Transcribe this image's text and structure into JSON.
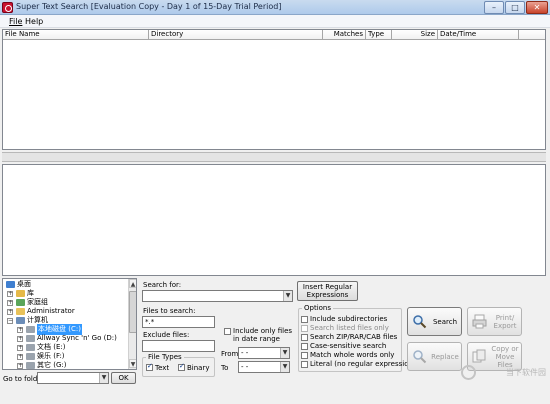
{
  "window": {
    "title": "Super Text Search [Evaluation Copy - Day 1 of 15-Day Trial Period]",
    "buttons": [
      "–",
      "□",
      "✕"
    ]
  },
  "menu": [
    "File",
    "Help"
  ],
  "results": {
    "columns": [
      "File Name",
      "Directory",
      "Matches",
      "Type",
      "Size",
      "Date/Time"
    ]
  },
  "folder_tree": {
    "items": [
      {
        "label": "桌面",
        "icon": "desktop-icon"
      },
      {
        "label": "库",
        "icon": "library-icon"
      },
      {
        "label": "家庭组",
        "icon": "homegroup-icon"
      },
      {
        "label": "Administrator",
        "icon": "user-folder-icon"
      },
      {
        "label": "计算机",
        "icon": "computer-icon"
      },
      {
        "label": "本地磁盘 (C:)",
        "icon": "drive-icon",
        "selected": true
      },
      {
        "label": "Allway Sync 'n' Go (D:)",
        "icon": "drive-icon"
      },
      {
        "label": "文档 (E:)",
        "icon": "drive-icon"
      },
      {
        "label": "娱乐 (F:)",
        "icon": "drive-icon"
      },
      {
        "label": "其它 (G:)",
        "icon": "drive-icon"
      }
    ],
    "expander": "+"
  },
  "goto": {
    "label": "Go to folder",
    "value": "",
    "ok_label": "OK"
  },
  "search": {
    "search_for_label": "Search for:",
    "search_for_value": "",
    "files_to_search_label": "Files to search:",
    "files_to_search_value": "*.*",
    "exclude_files_label": "Exclude files:",
    "exclude_files_value": "",
    "insert_regex_label": "Insert Regular Expressions",
    "date_range": {
      "include_label": "Include only files in date range",
      "from_label": "From",
      "from_value": "- -",
      "to_label": "To",
      "to_value": "- -"
    },
    "file_types": {
      "title": "File Types",
      "text_label": "Text",
      "binary_label": "Binary",
      "text_checked": true,
      "binary_checked": true
    },
    "options": {
      "title": "Options",
      "items": [
        {
          "label": "Include subdirectories",
          "checked": false,
          "enabled": true
        },
        {
          "label": "Search listed files only",
          "checked": false,
          "enabled": false
        },
        {
          "label": "Search ZIP/RAR/CAB files",
          "checked": false,
          "enabled": true
        },
        {
          "label": "Case-sensitive search",
          "checked": false,
          "enabled": true
        },
        {
          "label": "Match whole words only",
          "checked": false,
          "enabled": true
        },
        {
          "label": "Literal (no regular expressions)",
          "checked": false,
          "enabled": true
        }
      ]
    }
  },
  "actions": {
    "search_label": "Search",
    "print_export_label": "Print/ Export",
    "replace_label": "Replace",
    "copy_move_label": "Copy or Move Files"
  },
  "watermark": "当下软件园",
  "colors": {
    "titlebar": "#bcd2ec",
    "selection": "#3399ff",
    "close_button": "#c8432b"
  }
}
